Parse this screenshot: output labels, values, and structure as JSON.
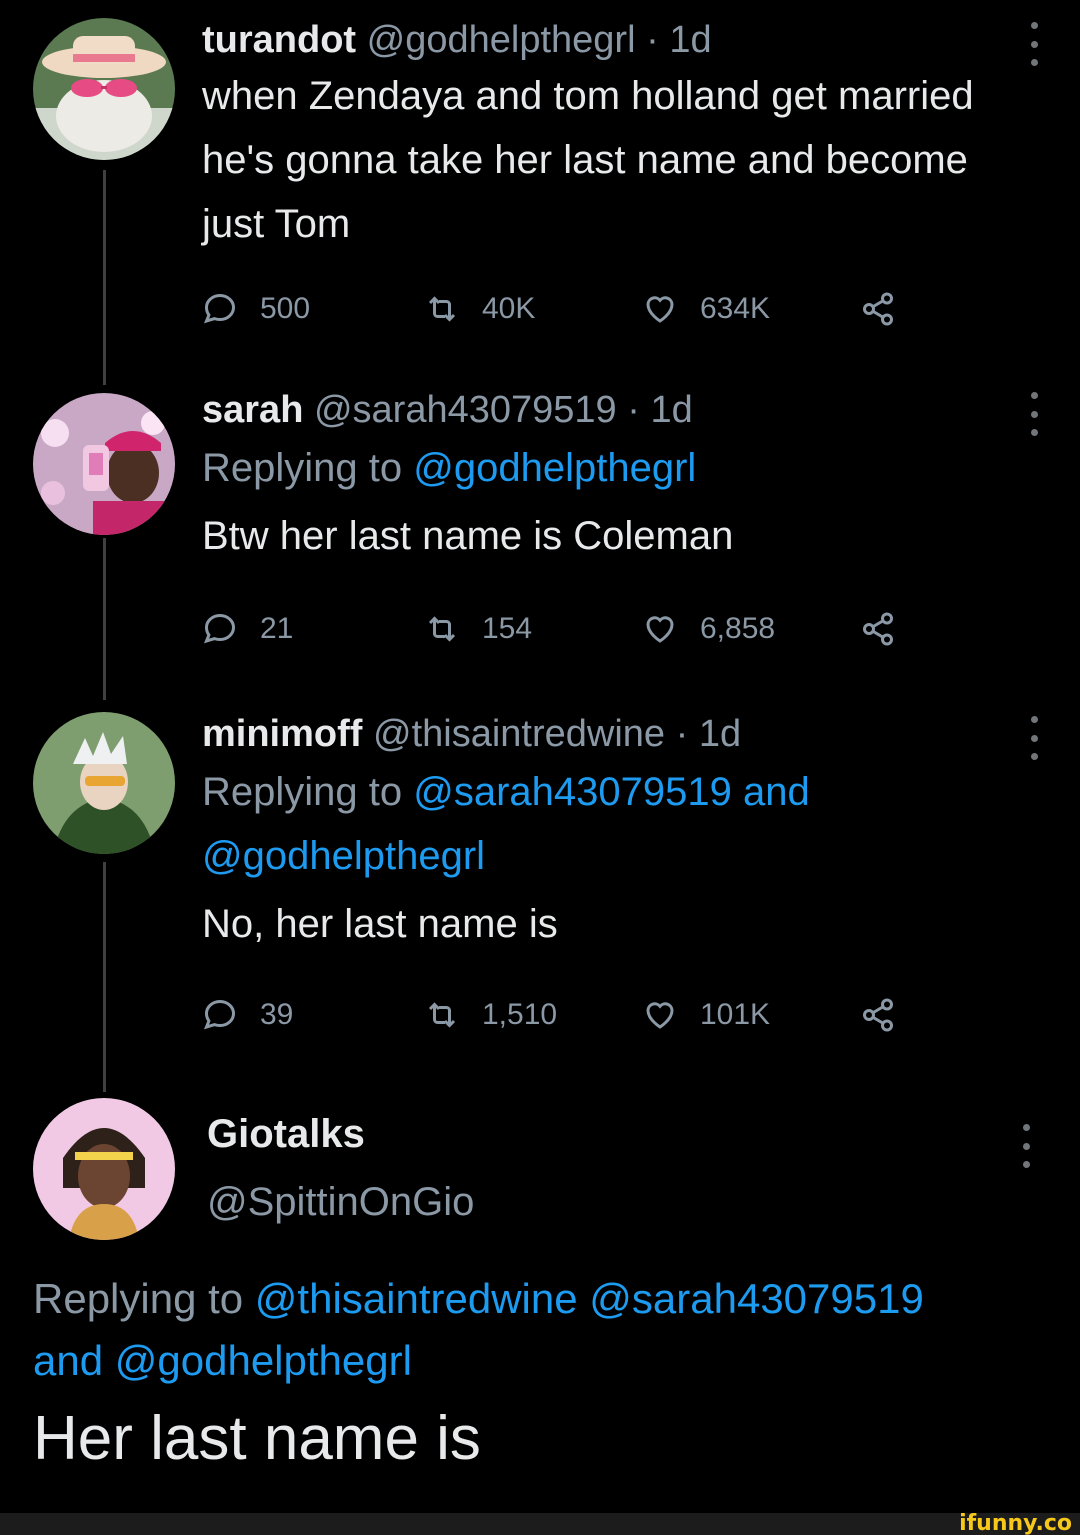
{
  "thread": [
    {
      "name": "turandot",
      "handle": "@godhelpthegrl",
      "separator": "·",
      "time": "1d",
      "replying_prefix": "",
      "replying_mentions": [],
      "replying_joiner": "",
      "text": "when Zendaya and tom holland get married he's gonna take her last name and become just Tom",
      "stats": {
        "replies": "500",
        "retweets": "40K",
        "likes": "634K"
      },
      "avatar": "cat-in-sunhat"
    },
    {
      "name": "sarah",
      "handle": "@sarah43079519",
      "separator": "·",
      "time": "1d",
      "replying_prefix": "Replying to",
      "replying_mentions": [
        "@godhelpthegrl"
      ],
      "text": "Btw her last name is Coleman",
      "stats": {
        "replies": "21",
        "retweets": "154",
        "likes": "6,858"
      },
      "avatar": "man-with-phone-sparkles"
    },
    {
      "name": "minimoff",
      "handle": "@thisaintredwine",
      "separator": "·",
      "time": "1d",
      "replying_prefix": "Replying to",
      "replying_mentions": [
        "@sarah43079519",
        "and",
        "@godhelpthegrl"
      ],
      "text": "No, her last name is",
      "stats": {
        "replies": "39",
        "retweets": "1,510",
        "likes": "101K"
      },
      "avatar": "comic-hero-green-suit"
    }
  ],
  "main_tweet": {
    "name": "Giotalks",
    "handle": "@SpittinOnGio",
    "replying_prefix": "Replying to",
    "replying_mentions_line": "@thisaintredwine @sarah43079519",
    "replying_tail_and": "and",
    "replying_tail_mention": "@godhelpthegrl",
    "text": "Her last name is",
    "avatar": "man-with-headband"
  },
  "watermark": "ifunny.co",
  "colors": {
    "background": "#000000",
    "primary_text": "#e7e9ea",
    "secondary_text": "#8b98a5",
    "mention": "#1d9bf0",
    "thread_line": "#3e4144",
    "watermark": "#f6c81c"
  },
  "icons": [
    "reply-icon",
    "retweet-icon",
    "like-icon",
    "share-icon",
    "more-icon"
  ]
}
